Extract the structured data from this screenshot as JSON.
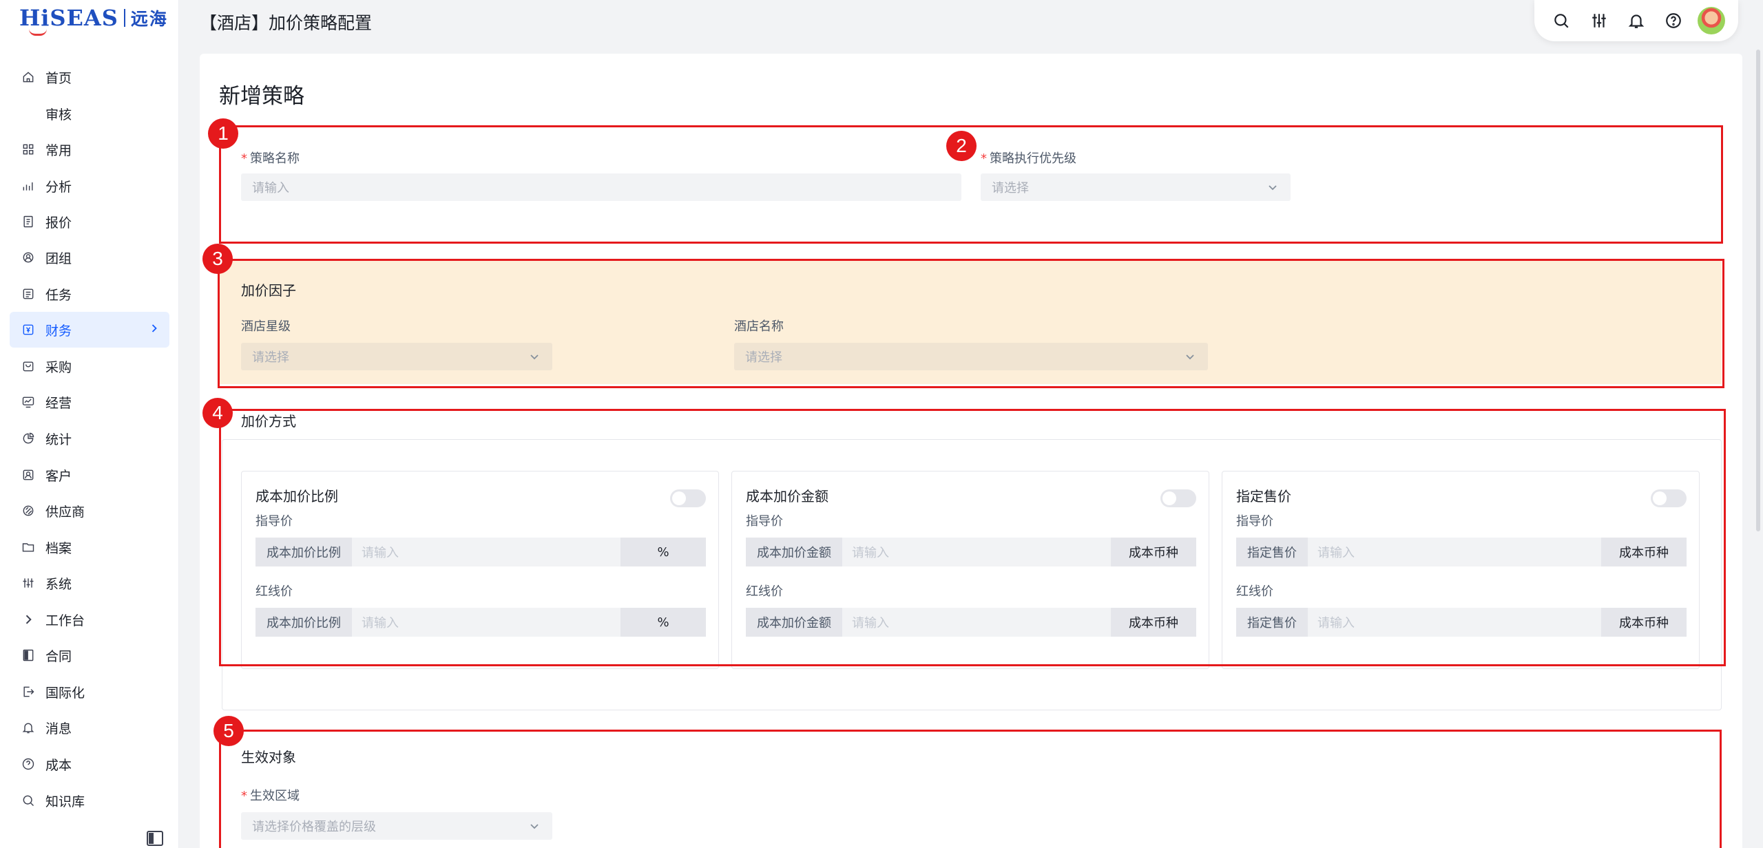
{
  "logo": {
    "brand": "HiSEAS",
    "cn": "远海"
  },
  "sidebar": {
    "items": [
      {
        "label": "首页",
        "icon": "home-icon"
      },
      {
        "label": "审核",
        "icon": ""
      },
      {
        "label": "常用",
        "icon": "grid-icon"
      },
      {
        "label": "分析",
        "icon": "chart-icon"
      },
      {
        "label": "报价",
        "icon": "document-icon"
      },
      {
        "label": "团组",
        "icon": "team-icon"
      },
      {
        "label": "任务",
        "icon": "task-icon"
      },
      {
        "label": "财务",
        "icon": "finance-icon",
        "active": true
      },
      {
        "label": "采购",
        "icon": "purchase-icon"
      },
      {
        "label": "经营",
        "icon": "operation-icon"
      },
      {
        "label": "统计",
        "icon": "pie-chart-icon"
      },
      {
        "label": "客户",
        "icon": "customer-icon"
      },
      {
        "label": "供应商",
        "icon": "supplier-icon"
      },
      {
        "label": "档案",
        "icon": "folder-icon"
      },
      {
        "label": "系统",
        "icon": "sliders-icon"
      },
      {
        "label": "工作台",
        "icon": "chevron-right-icon"
      },
      {
        "label": "合同",
        "icon": "contract-icon"
      },
      {
        "label": "国际化",
        "icon": "export-icon"
      },
      {
        "label": "消息",
        "icon": "bell-icon"
      },
      {
        "label": "成本",
        "icon": "help-icon"
      },
      {
        "label": "知识库",
        "icon": "search-icon"
      }
    ]
  },
  "header": {
    "title": "【酒店】加价策略配置"
  },
  "toolbar": {
    "icons": [
      "search-icon",
      "sliders-icon",
      "bell-icon",
      "help-icon",
      "avatar"
    ]
  },
  "card": {
    "title": "新增策略"
  },
  "basic": {
    "name_label": "策略名称",
    "name_placeholder": "请输入",
    "priority_label": "策略执行优先级",
    "priority_placeholder": "请选择"
  },
  "factor": {
    "title": "加价因子",
    "star_label": "酒店星级",
    "star_placeholder": "请选择",
    "hotel_label": "酒店名称",
    "hotel_placeholder": "请选择"
  },
  "method": {
    "title": "加价方式",
    "blocks": [
      {
        "title": "成本加价比例",
        "guide_label": "指导价",
        "red_label": "红线价",
        "prefix": "成本加价比例",
        "placeholder": "请输入",
        "suffix": "%",
        "enabled": false
      },
      {
        "title": "成本加价金额",
        "guide_label": "指导价",
        "red_label": "红线价",
        "prefix": "成本加价金额",
        "placeholder": "请输入",
        "suffix": "成本币种",
        "enabled": false
      },
      {
        "title": "指定售价",
        "guide_label": "指导价",
        "red_label": "红线价",
        "prefix": "指定售价",
        "placeholder": "请输入",
        "suffix": "成本币种",
        "enabled": false
      }
    ]
  },
  "target": {
    "title": "生效对象",
    "region_label": "生效区域",
    "region_placeholder": "请选择价格覆盖的层级"
  },
  "annotations": [
    "1",
    "2",
    "3",
    "4",
    "5"
  ],
  "colors": {
    "accent": "#165dff",
    "annotation": "#e5191c",
    "factor_bg": "#fdefd9"
  }
}
